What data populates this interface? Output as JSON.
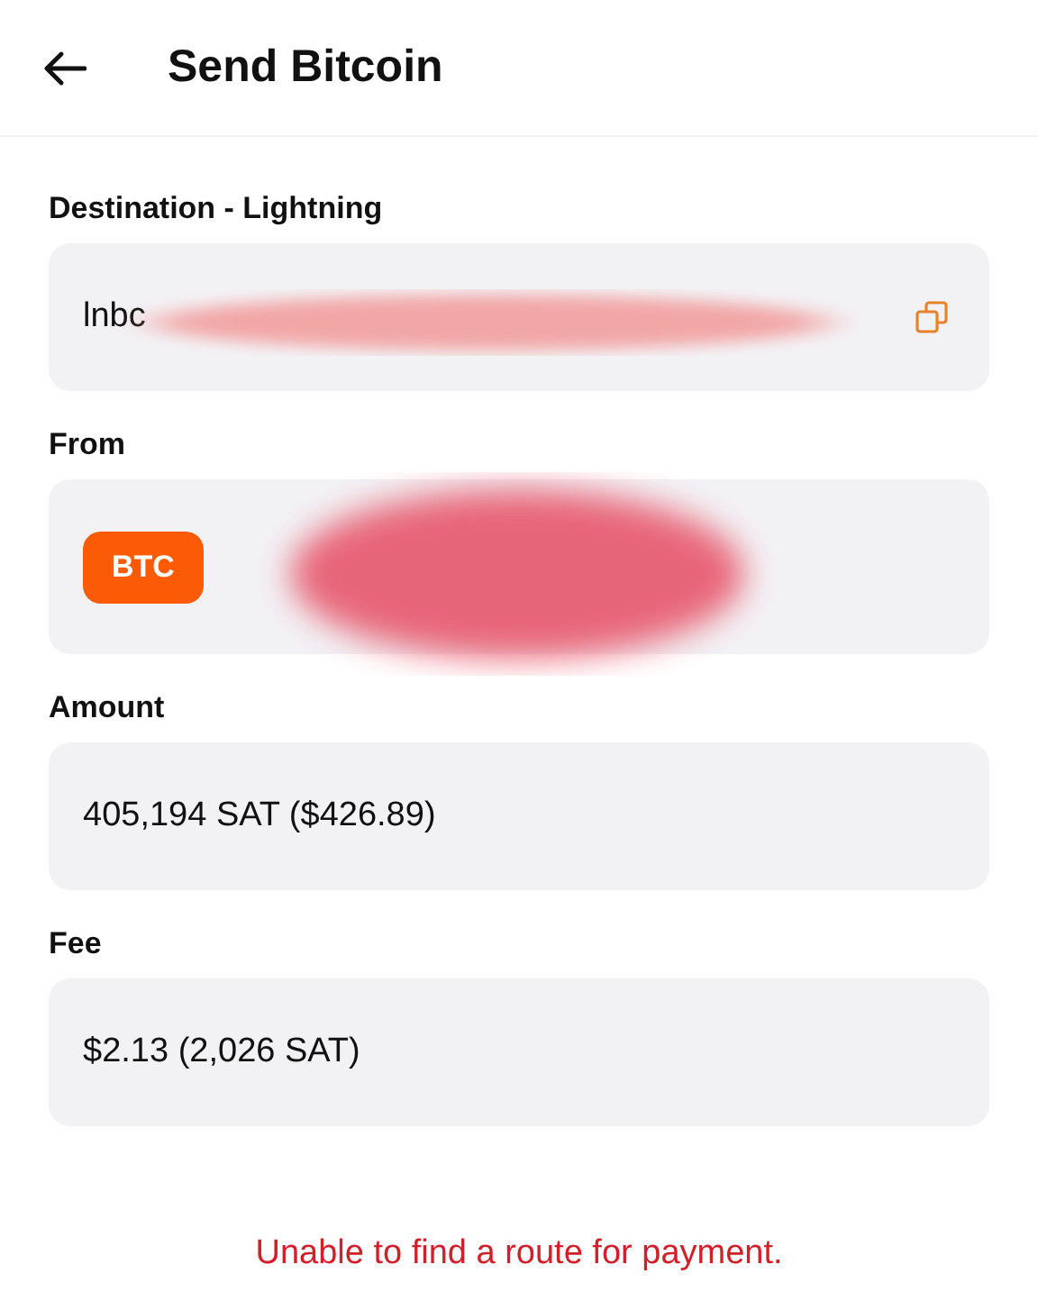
{
  "header": {
    "title": "Send Bitcoin"
  },
  "fields": [
    {
      "kind": "address",
      "label": "Destination - Lightning",
      "value": "lnbc",
      "redacted": true,
      "copy": true
    },
    {
      "kind": "account",
      "label": "From",
      "badge": "BTC",
      "redacted": true
    },
    {
      "kind": "text",
      "label": "Amount",
      "value": "405,194 SAT ($426.89)"
    },
    {
      "kind": "text",
      "label": "Fee",
      "value": "$2.13 (2,026 SAT)"
    }
  ],
  "error": "Unable to find a route for payment."
}
